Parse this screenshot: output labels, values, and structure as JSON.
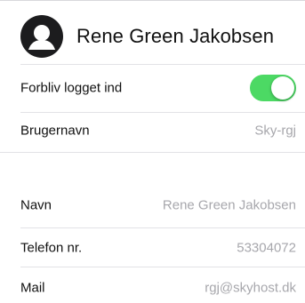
{
  "profile": {
    "name": "Rene Green Jakobsen",
    "avatar_icon": "user-avatar-icon"
  },
  "settings": {
    "stay_logged_in": {
      "label": "Forbliv logget ind",
      "enabled": true,
      "toggle_color": "#4cd964"
    },
    "username": {
      "label": "Brugernavn",
      "value": "Sky-rgj"
    }
  },
  "details": [
    {
      "label": "Navn",
      "value": "Rene Green Jakobsen"
    },
    {
      "label": "Telefon nr.",
      "value": "53304072"
    },
    {
      "label": "Mail",
      "value": "rgj@skyhost.dk"
    }
  ]
}
